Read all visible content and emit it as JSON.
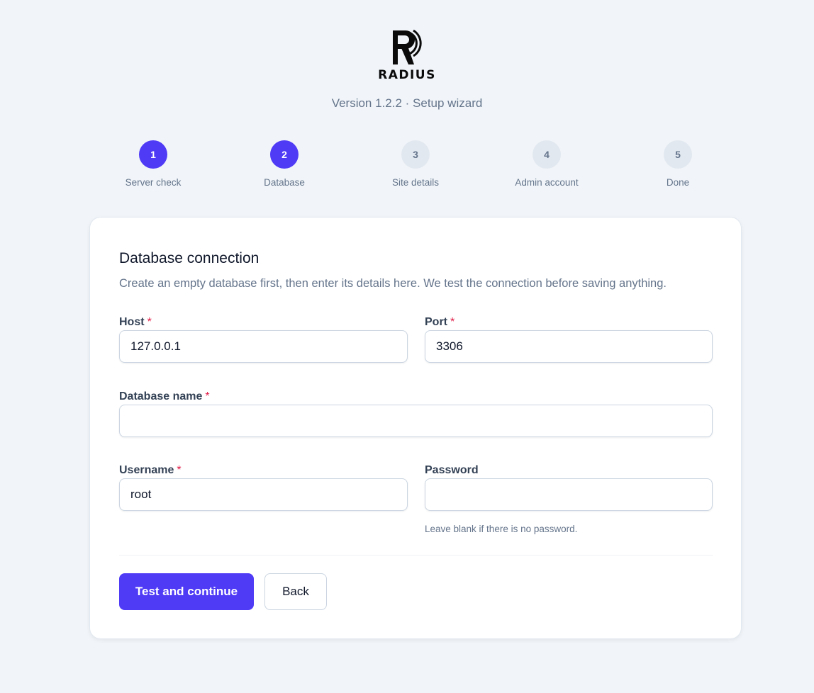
{
  "brand": {
    "name": "RADIUS",
    "version_line": "Version 1.2.2 · Setup wizard"
  },
  "steps": [
    {
      "number": "1",
      "label": "Server check",
      "state": "complete"
    },
    {
      "number": "2",
      "label": "Database",
      "state": "current"
    },
    {
      "number": "3",
      "label": "Site details",
      "state": "upcoming"
    },
    {
      "number": "4",
      "label": "Admin account",
      "state": "upcoming"
    },
    {
      "number": "5",
      "label": "Done",
      "state": "upcoming"
    }
  ],
  "form": {
    "title": "Database connection",
    "description": "Create an empty database first, then enter its details here. We test the connection before saving anything.",
    "required_marker": "*",
    "host": {
      "label": "Host",
      "value": "127.0.0.1",
      "required": true
    },
    "port": {
      "label": "Port",
      "value": "3306",
      "required": true
    },
    "database": {
      "label": "Database name",
      "value": "",
      "required": true
    },
    "username": {
      "label": "Username",
      "value": "root",
      "required": true
    },
    "password": {
      "label": "Password",
      "value": "",
      "required": false,
      "hint": "Leave blank if there is no password."
    }
  },
  "actions": {
    "primary_label": "Test and continue",
    "secondary_label": "Back"
  },
  "colors": {
    "accent": "#4f3af6",
    "background": "#f1f5f9",
    "required": "#e11d48",
    "muted_text": "#64748b"
  }
}
